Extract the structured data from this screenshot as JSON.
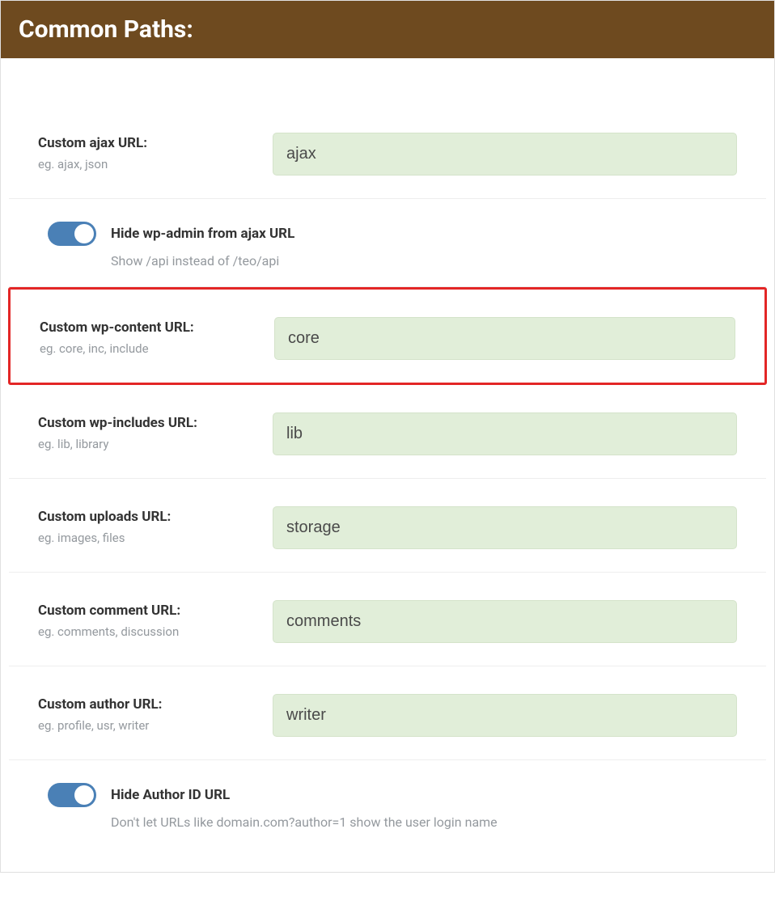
{
  "header": {
    "title": "Common Paths:"
  },
  "fields": {
    "ajax": {
      "label": "Custom ajax URL:",
      "hint": "eg. ajax, json",
      "value": "ajax"
    },
    "wpcontent": {
      "label": "Custom wp-content URL:",
      "hint": "eg. core, inc, include",
      "value": "core"
    },
    "wpincludes": {
      "label": "Custom wp-includes URL:",
      "hint": "eg. lib, library",
      "value": "lib"
    },
    "uploads": {
      "label": "Custom uploads URL:",
      "hint": "eg. images, files",
      "value": "storage"
    },
    "comment": {
      "label": "Custom comment URL:",
      "hint": "eg. comments, discussion",
      "value": "comments"
    },
    "author": {
      "label": "Custom author URL:",
      "hint": "eg. profile, usr, writer",
      "value": "writer"
    }
  },
  "toggles": {
    "hide_wpadmin": {
      "label": "Hide wp-admin from ajax URL",
      "desc": "Show /api instead of /teo/api",
      "on": true
    },
    "hide_author_id": {
      "label": "Hide Author ID URL",
      "desc": "Don't let URLs like domain.com?author=1 show the user login name",
      "on": true
    }
  },
  "colors": {
    "header_bg": "#6e4a1f",
    "input_bg": "#e1eed9",
    "toggle_on": "#4a80b6",
    "highlight_border": "#e32626"
  }
}
